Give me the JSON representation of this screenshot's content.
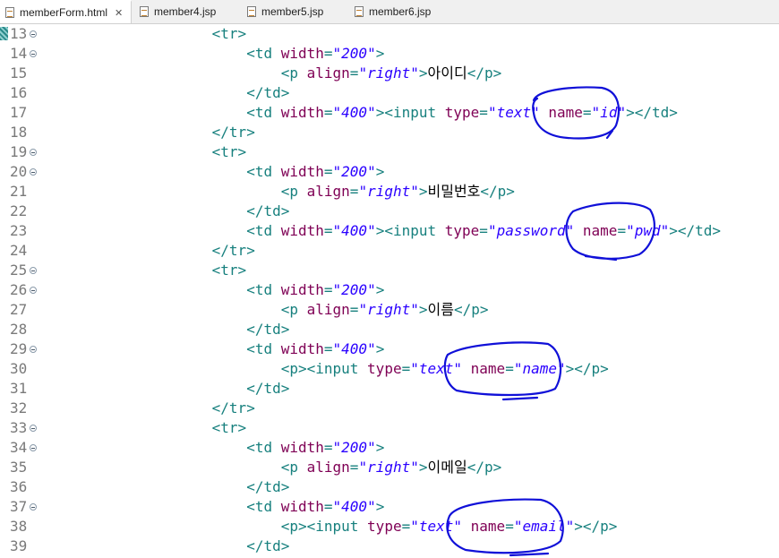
{
  "tabs": [
    {
      "label": "memberForm.html",
      "active": true,
      "closable": true
    },
    {
      "label": "member4.jsp",
      "active": false
    },
    {
      "label": "member5.jsp",
      "active": false
    },
    {
      "label": "member6.jsp",
      "active": false
    }
  ],
  "close_glyph": "✕",
  "colors": {
    "tag": "#17807e",
    "attribute": "#7f0055",
    "value": "#2a00ff",
    "text": "#000000",
    "line_number": "#7a7a7a",
    "annotation_ink": "#1010d8"
  },
  "lines": [
    {
      "n": "13",
      "fold": true,
      "indent": 20,
      "tokens": [
        {
          "t": "tag",
          "v": "<tr>"
        }
      ]
    },
    {
      "n": "14",
      "fold": true,
      "indent": 24,
      "tokens": [
        {
          "t": "tag",
          "v": "<td "
        },
        {
          "t": "attr",
          "v": "width"
        },
        {
          "t": "tag",
          "v": "="
        },
        {
          "t": "val",
          "v": "\"200\""
        },
        {
          "t": "tag",
          "v": ">"
        }
      ]
    },
    {
      "n": "15",
      "fold": false,
      "indent": 28,
      "tokens": [
        {
          "t": "tag",
          "v": "<p "
        },
        {
          "t": "attr",
          "v": "align"
        },
        {
          "t": "tag",
          "v": "="
        },
        {
          "t": "val",
          "v": "\"right\""
        },
        {
          "t": "tag",
          "v": ">"
        },
        {
          "t": "txt",
          "v": "아이디"
        },
        {
          "t": "tag",
          "v": "</p>"
        }
      ]
    },
    {
      "n": "16",
      "fold": false,
      "indent": 24,
      "tokens": [
        {
          "t": "tag",
          "v": "</td>"
        }
      ]
    },
    {
      "n": "17",
      "fold": false,
      "indent": 24,
      "tokens": [
        {
          "t": "tag",
          "v": "<td "
        },
        {
          "t": "attr",
          "v": "width"
        },
        {
          "t": "tag",
          "v": "="
        },
        {
          "t": "val",
          "v": "\"400\""
        },
        {
          "t": "tag",
          "v": "><input "
        },
        {
          "t": "attr",
          "v": "type"
        },
        {
          "t": "tag",
          "v": "="
        },
        {
          "t": "val",
          "v": "\"text\""
        },
        {
          "t": "tag",
          "v": " "
        },
        {
          "t": "attr",
          "v": "name"
        },
        {
          "t": "tag",
          "v": "="
        },
        {
          "t": "val",
          "v": "\"id\""
        },
        {
          "t": "tag",
          "v": "></td>"
        }
      ]
    },
    {
      "n": "18",
      "fold": false,
      "indent": 20,
      "tokens": [
        {
          "t": "tag",
          "v": "</tr>"
        }
      ]
    },
    {
      "n": "19",
      "fold": true,
      "indent": 20,
      "tokens": [
        {
          "t": "tag",
          "v": "<tr>"
        }
      ]
    },
    {
      "n": "20",
      "fold": true,
      "indent": 24,
      "tokens": [
        {
          "t": "tag",
          "v": "<td "
        },
        {
          "t": "attr",
          "v": "width"
        },
        {
          "t": "tag",
          "v": "="
        },
        {
          "t": "val",
          "v": "\"200\""
        },
        {
          "t": "tag",
          "v": ">"
        }
      ]
    },
    {
      "n": "21",
      "fold": false,
      "indent": 28,
      "tokens": [
        {
          "t": "tag",
          "v": "<p "
        },
        {
          "t": "attr",
          "v": "align"
        },
        {
          "t": "tag",
          "v": "="
        },
        {
          "t": "val",
          "v": "\"right\""
        },
        {
          "t": "tag",
          "v": ">"
        },
        {
          "t": "txt",
          "v": "비밀번호"
        },
        {
          "t": "tag",
          "v": "</p>"
        }
      ]
    },
    {
      "n": "22",
      "fold": false,
      "indent": 24,
      "tokens": [
        {
          "t": "tag",
          "v": "</td>"
        }
      ]
    },
    {
      "n": "23",
      "fold": false,
      "indent": 24,
      "tokens": [
        {
          "t": "tag",
          "v": "<td "
        },
        {
          "t": "attr",
          "v": "width"
        },
        {
          "t": "tag",
          "v": "="
        },
        {
          "t": "val",
          "v": "\"400\""
        },
        {
          "t": "tag",
          "v": "><input "
        },
        {
          "t": "attr",
          "v": "type"
        },
        {
          "t": "tag",
          "v": "="
        },
        {
          "t": "val",
          "v": "\"password\""
        },
        {
          "t": "tag",
          "v": " "
        },
        {
          "t": "attr",
          "v": "name"
        },
        {
          "t": "tag",
          "v": "="
        },
        {
          "t": "val",
          "v": "\"pwd\""
        },
        {
          "t": "tag",
          "v": "></td>"
        }
      ]
    },
    {
      "n": "24",
      "fold": false,
      "indent": 20,
      "tokens": [
        {
          "t": "tag",
          "v": "</tr>"
        }
      ]
    },
    {
      "n": "25",
      "fold": true,
      "indent": 20,
      "tokens": [
        {
          "t": "tag",
          "v": "<tr>"
        }
      ]
    },
    {
      "n": "26",
      "fold": true,
      "indent": 24,
      "tokens": [
        {
          "t": "tag",
          "v": "<td "
        },
        {
          "t": "attr",
          "v": "width"
        },
        {
          "t": "tag",
          "v": "="
        },
        {
          "t": "val",
          "v": "\"200\""
        },
        {
          "t": "tag",
          "v": ">"
        }
      ]
    },
    {
      "n": "27",
      "fold": false,
      "indent": 28,
      "tokens": [
        {
          "t": "tag",
          "v": "<p "
        },
        {
          "t": "attr",
          "v": "align"
        },
        {
          "t": "tag",
          "v": "="
        },
        {
          "t": "val",
          "v": "\"right\""
        },
        {
          "t": "tag",
          "v": ">"
        },
        {
          "t": "txt",
          "v": "이름"
        },
        {
          "t": "tag",
          "v": "</p>"
        }
      ]
    },
    {
      "n": "28",
      "fold": false,
      "indent": 24,
      "tokens": [
        {
          "t": "tag",
          "v": "</td>"
        }
      ]
    },
    {
      "n": "29",
      "fold": true,
      "indent": 24,
      "tokens": [
        {
          "t": "tag",
          "v": "<td "
        },
        {
          "t": "attr",
          "v": "width"
        },
        {
          "t": "tag",
          "v": "="
        },
        {
          "t": "val",
          "v": "\"400\""
        },
        {
          "t": "tag",
          "v": ">"
        }
      ]
    },
    {
      "n": "30",
      "fold": false,
      "indent": 28,
      "tokens": [
        {
          "t": "tag",
          "v": "<p><input "
        },
        {
          "t": "attr",
          "v": "type"
        },
        {
          "t": "tag",
          "v": "="
        },
        {
          "t": "val",
          "v": "\"text\""
        },
        {
          "t": "tag",
          "v": " "
        },
        {
          "t": "attr",
          "v": "name"
        },
        {
          "t": "tag",
          "v": "="
        },
        {
          "t": "val",
          "v": "\"name\""
        },
        {
          "t": "tag",
          "v": "></p>"
        }
      ]
    },
    {
      "n": "31",
      "fold": false,
      "indent": 24,
      "tokens": [
        {
          "t": "tag",
          "v": "</td>"
        }
      ]
    },
    {
      "n": "32",
      "fold": false,
      "indent": 20,
      "tokens": [
        {
          "t": "tag",
          "v": "</tr>"
        }
      ]
    },
    {
      "n": "33",
      "fold": true,
      "indent": 20,
      "tokens": [
        {
          "t": "tag",
          "v": "<tr>"
        }
      ]
    },
    {
      "n": "34",
      "fold": true,
      "indent": 24,
      "tokens": [
        {
          "t": "tag",
          "v": "<td "
        },
        {
          "t": "attr",
          "v": "width"
        },
        {
          "t": "tag",
          "v": "="
        },
        {
          "t": "val",
          "v": "\"200\""
        },
        {
          "t": "tag",
          "v": ">"
        }
      ]
    },
    {
      "n": "35",
      "fold": false,
      "indent": 28,
      "tokens": [
        {
          "t": "tag",
          "v": "<p "
        },
        {
          "t": "attr",
          "v": "align"
        },
        {
          "t": "tag",
          "v": "="
        },
        {
          "t": "val",
          "v": "\"right\""
        },
        {
          "t": "tag",
          "v": ">"
        },
        {
          "t": "txt",
          "v": "이메일"
        },
        {
          "t": "tag",
          "v": "</p>"
        }
      ]
    },
    {
      "n": "36",
      "fold": false,
      "indent": 24,
      "tokens": [
        {
          "t": "tag",
          "v": "</td>"
        }
      ]
    },
    {
      "n": "37",
      "fold": true,
      "indent": 24,
      "tokens": [
        {
          "t": "tag",
          "v": "<td "
        },
        {
          "t": "attr",
          "v": "width"
        },
        {
          "t": "tag",
          "v": "="
        },
        {
          "t": "val",
          "v": "\"400\""
        },
        {
          "t": "tag",
          "v": ">"
        }
      ]
    },
    {
      "n": "38",
      "fold": false,
      "indent": 28,
      "tokens": [
        {
          "t": "tag",
          "v": "<p><input "
        },
        {
          "t": "attr",
          "v": "type"
        },
        {
          "t": "tag",
          "v": "="
        },
        {
          "t": "val",
          "v": "\"text\""
        },
        {
          "t": "tag",
          "v": " "
        },
        {
          "t": "attr",
          "v": "name"
        },
        {
          "t": "tag",
          "v": "="
        },
        {
          "t": "val",
          "v": "\"email\""
        },
        {
          "t": "tag",
          "v": "></p>"
        }
      ]
    },
    {
      "n": "39",
      "fold": false,
      "indent": 24,
      "tokens": [
        {
          "t": "tag",
          "v": "</td>"
        }
      ]
    }
  ]
}
